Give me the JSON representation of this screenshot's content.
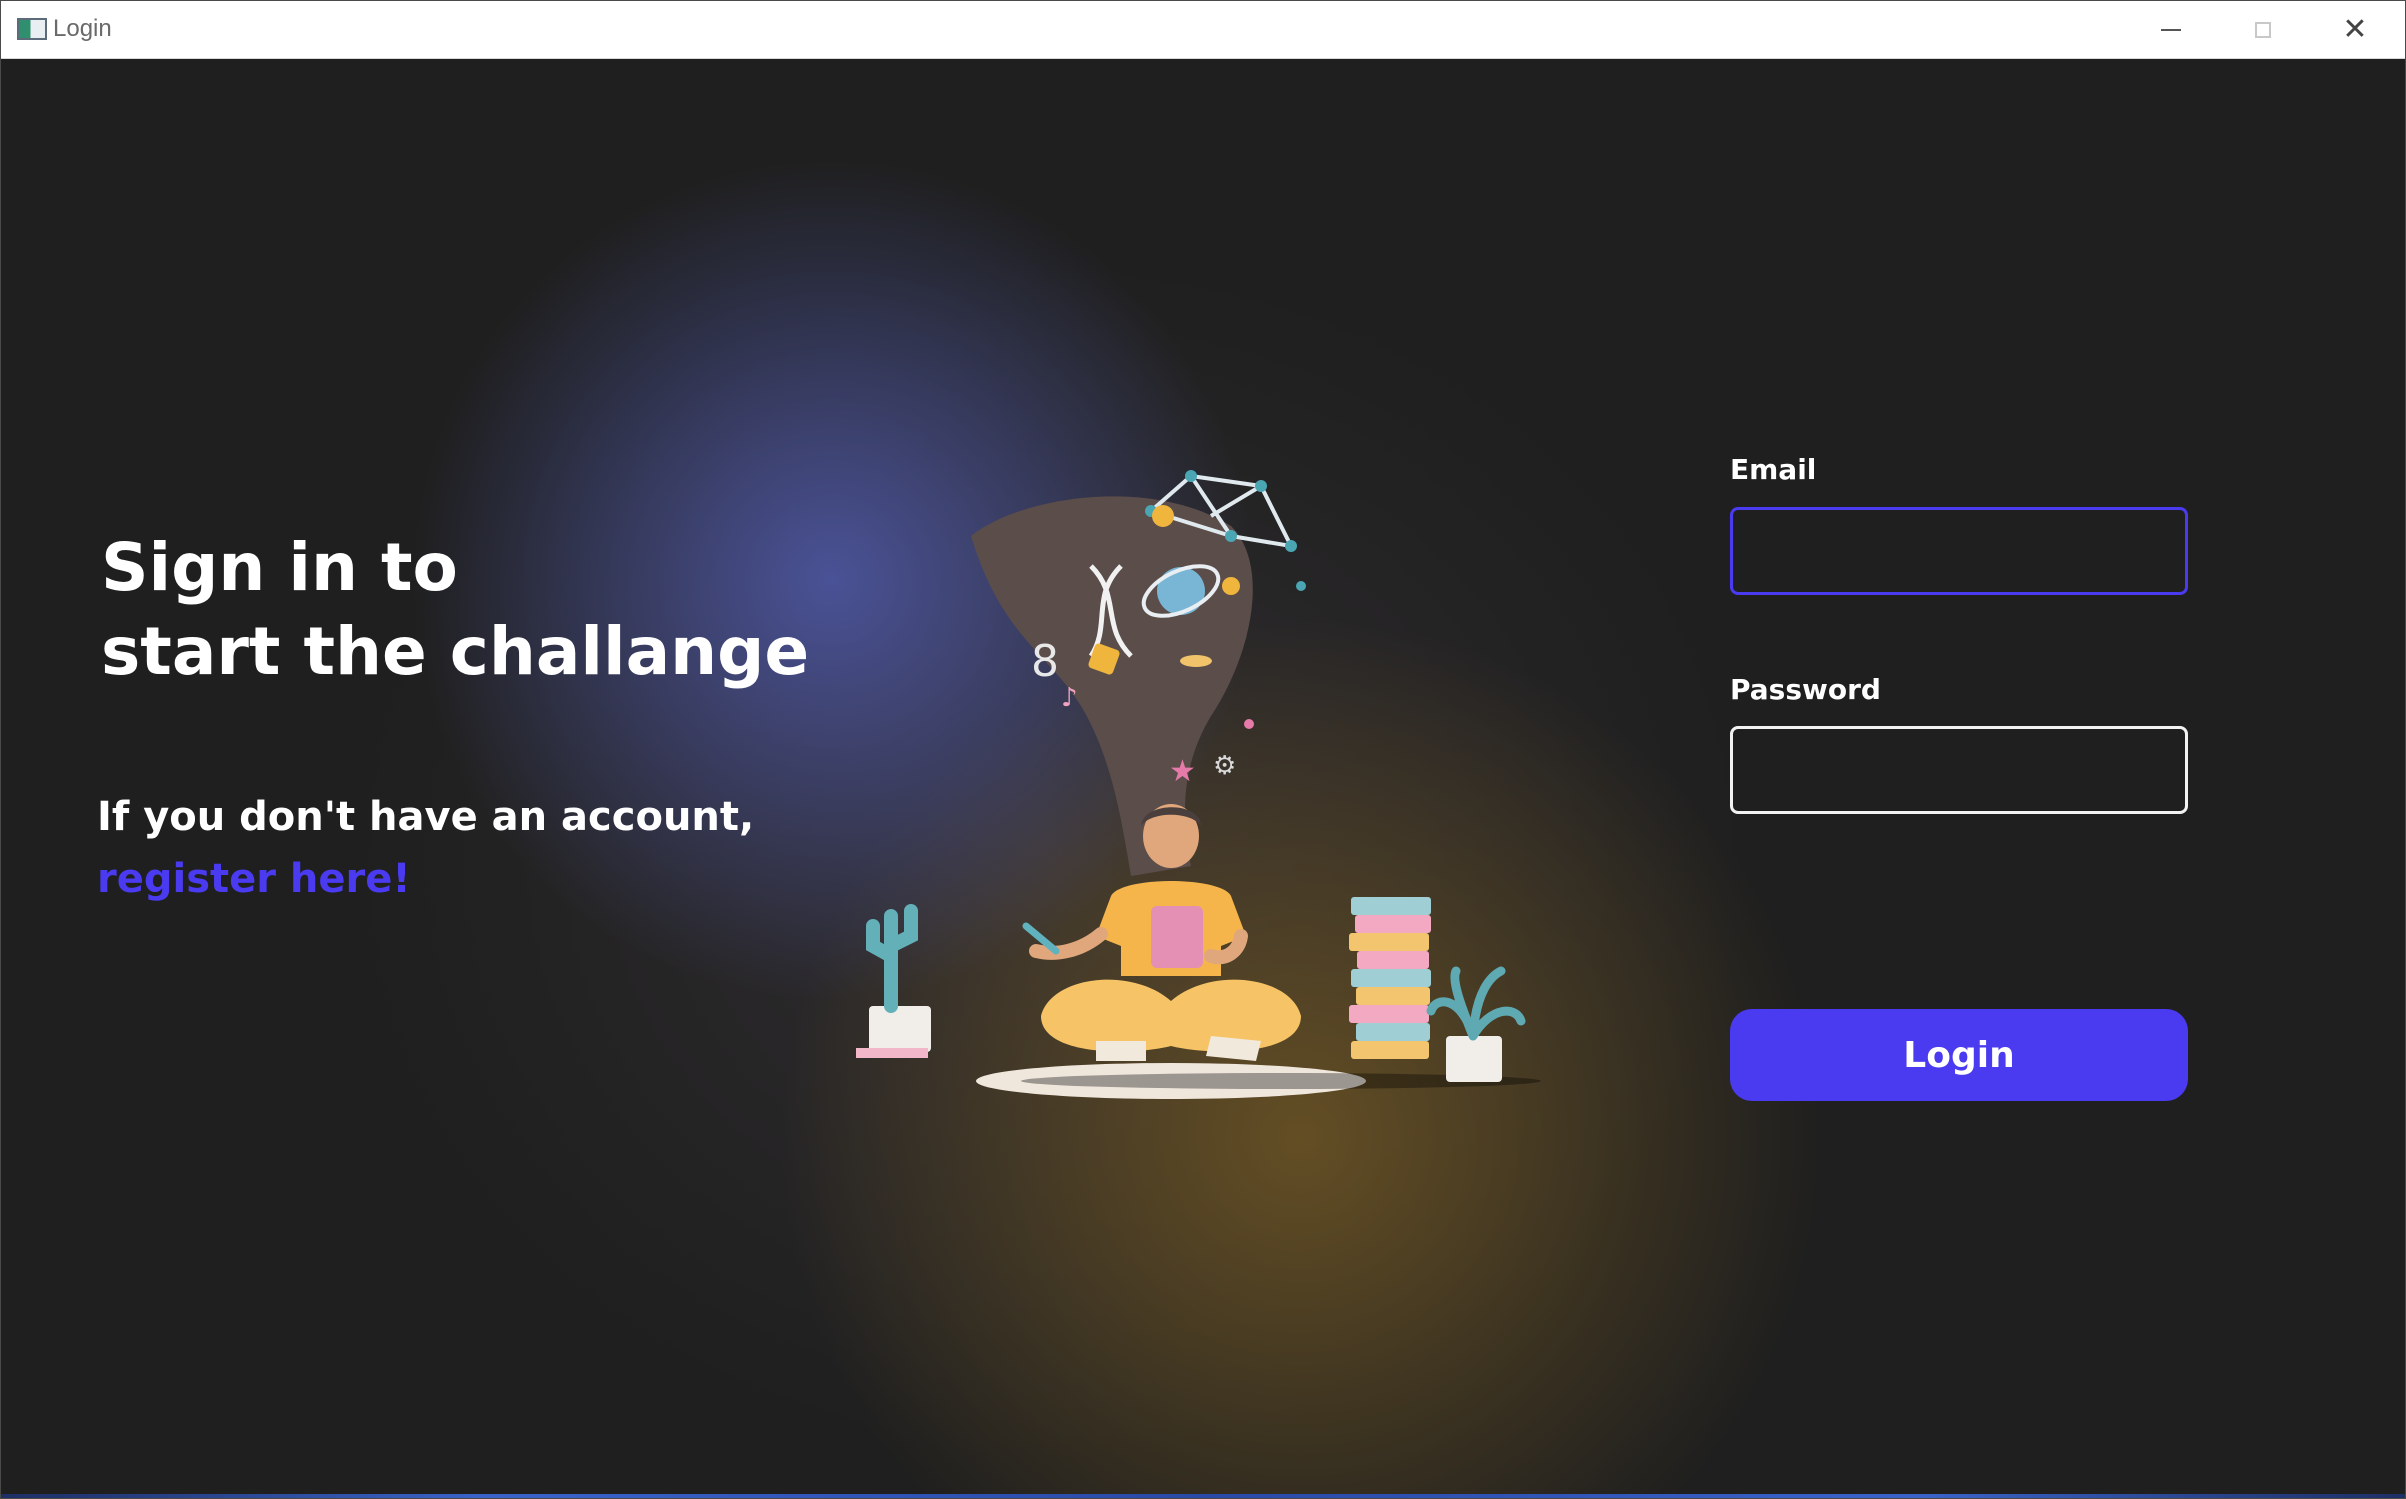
{
  "window": {
    "title": "Login",
    "controls": {
      "minimize_icon": "minimize-icon",
      "maximize_icon": "maximize-icon",
      "close_icon": "close-icon",
      "close_glyph": "✕"
    }
  },
  "hero": {
    "headline_line1": "Sign in to",
    "headline_line2": "start the challange",
    "register_prompt": "If you don't have an account,",
    "register_link": "register here!"
  },
  "illustration": {
    "icon": "person-reading-illustration"
  },
  "form": {
    "email_label": "Email",
    "email_value": "",
    "password_label": "Password",
    "password_value": "",
    "login_button": "Login"
  },
  "colors": {
    "accent": "#4a3af0",
    "background": "#1f1f1f",
    "text": "#ffffff"
  }
}
